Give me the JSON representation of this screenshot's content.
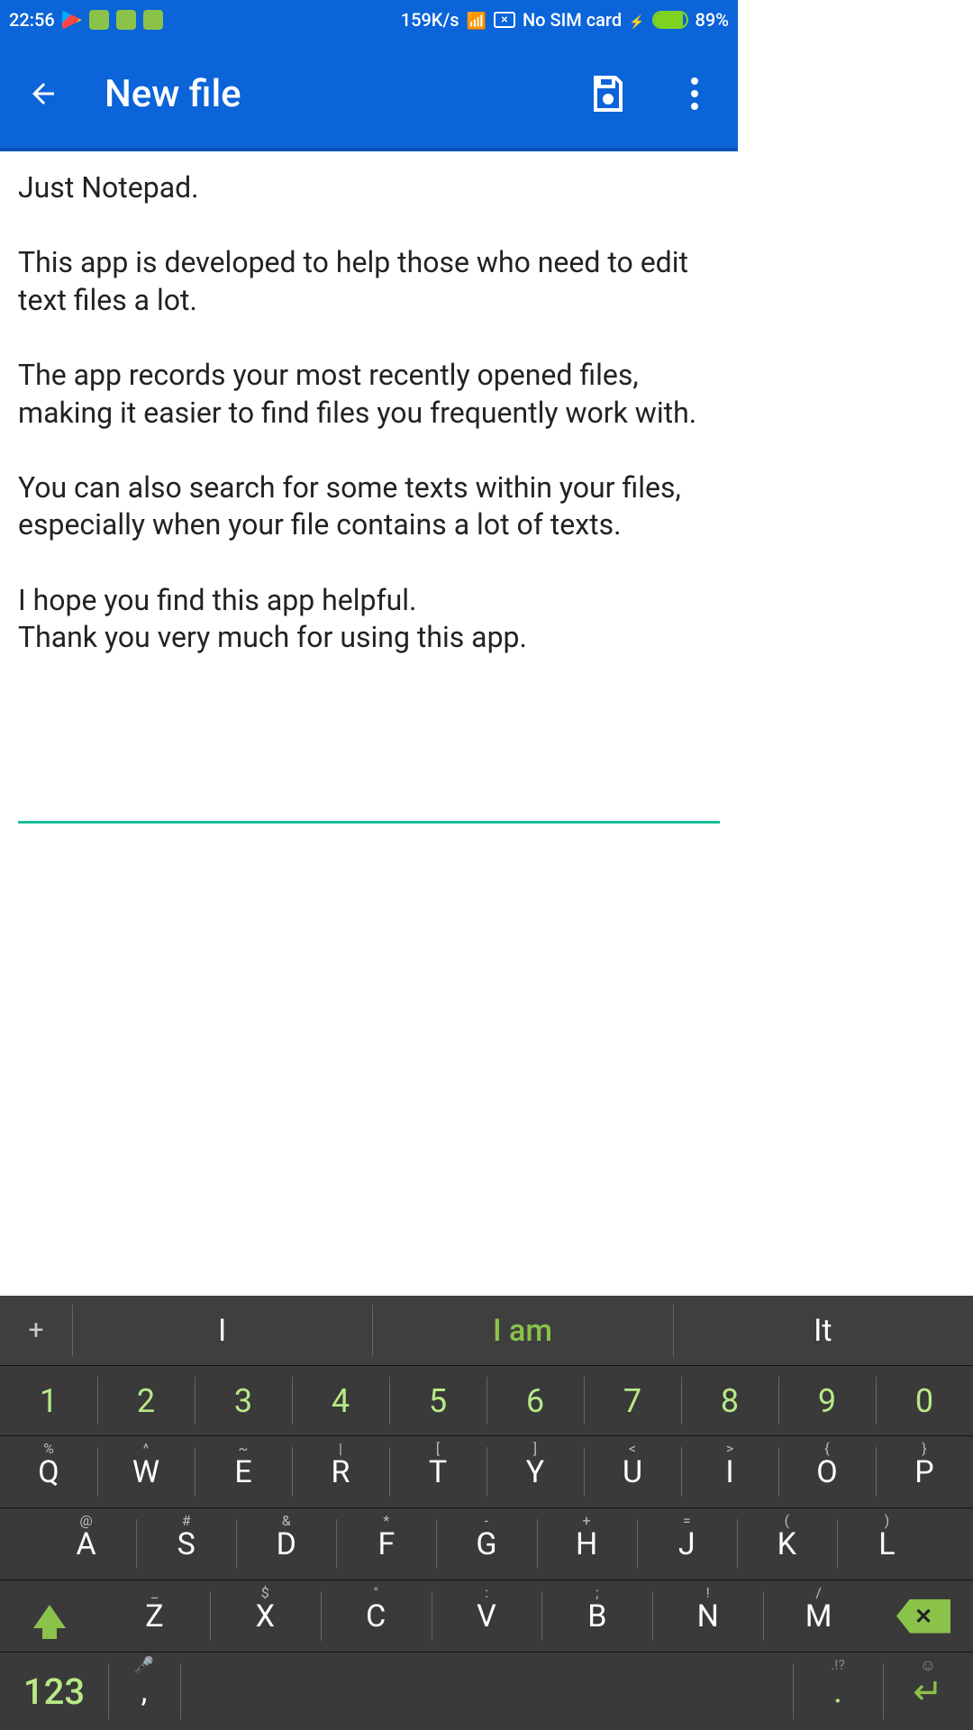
{
  "status": {
    "time": "22:56",
    "net_speed": "159K/s",
    "sim": "No SIM card",
    "battery_pct": "89%"
  },
  "appbar": {
    "title": "New file"
  },
  "editor": {
    "text": "Just Notepad.\n\nThis app is developed to help those who need to edit text files a lot.\n\nThe app records your most recently opened files, making it easier to find files you frequently work with.\n\nYou can also search for some texts within your files, especially when your file contains a lot of texts.\n\nI hope you find this app helpful.\nThank you very much for using this app.\n"
  },
  "keyboard": {
    "suggestions": {
      "plus": "+",
      "left": "I",
      "center": "I am",
      "right": "It"
    },
    "numbers": [
      "1",
      "2",
      "3",
      "4",
      "5",
      "6",
      "7",
      "8",
      "9",
      "0"
    ],
    "row1": [
      {
        "k": "Q",
        "a": "%"
      },
      {
        "k": "W",
        "a": "^"
      },
      {
        "k": "E",
        "a": "~"
      },
      {
        "k": "R",
        "a": "|"
      },
      {
        "k": "T",
        "a": "["
      },
      {
        "k": "Y",
        "a": "]"
      },
      {
        "k": "U",
        "a": "<"
      },
      {
        "k": "I",
        "a": ">"
      },
      {
        "k": "O",
        "a": "{"
      },
      {
        "k": "P",
        "a": "}"
      }
    ],
    "row2": [
      {
        "k": "A",
        "a": "@"
      },
      {
        "k": "S",
        "a": "#"
      },
      {
        "k": "D",
        "a": "&"
      },
      {
        "k": "F",
        "a": "*"
      },
      {
        "k": "G",
        "a": "-"
      },
      {
        "k": "H",
        "a": "+"
      },
      {
        "k": "J",
        "a": "="
      },
      {
        "k": "K",
        "a": "("
      },
      {
        "k": "L",
        "a": ")"
      }
    ],
    "row3": [
      {
        "k": "Z",
        "a": "_"
      },
      {
        "k": "X",
        "a": "$"
      },
      {
        "k": "C",
        "a": "\""
      },
      {
        "k": "V",
        "a": ":"
      },
      {
        "k": "B",
        "a": ";"
      },
      {
        "k": "N",
        "a": "!"
      },
      {
        "k": "M",
        "a": "/"
      }
    ],
    "bottom": {
      "mode": "123",
      "comma": ",",
      "dot": ".",
      "dot_alt": ".!?",
      "bksp_x": "✕"
    }
  }
}
